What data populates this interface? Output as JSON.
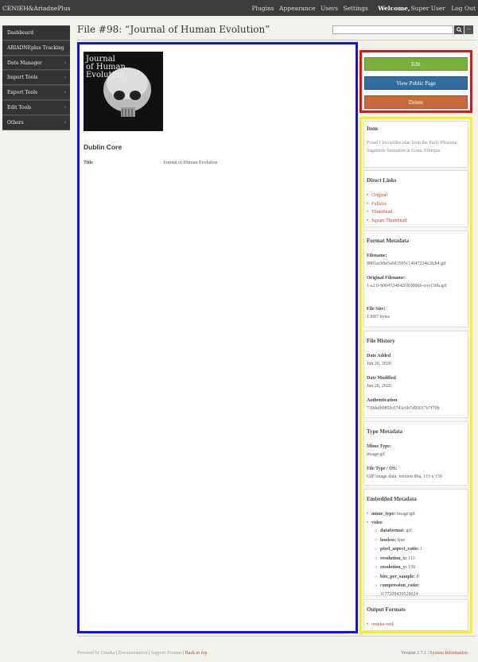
{
  "topbar": {
    "site_name": "CENIEH&AriadnePlus",
    "nav": [
      "Plugins",
      "Appearance",
      "Users",
      "Settings"
    ],
    "welcome": "Welcome,",
    "user": "Super User",
    "logout": "Log Out"
  },
  "sidebar": {
    "items": [
      {
        "label": "Dashboard",
        "chevron": ""
      },
      {
        "label": "ARIADNEplus Tracking",
        "chevron": ""
      },
      {
        "label": "Data Manager",
        "chevron": "›"
      },
      {
        "label": "Import Tools",
        "chevron": "›"
      },
      {
        "label": "Export Tools",
        "chevron": "›"
      },
      {
        "label": "Edit Tools",
        "chevron": "›"
      },
      {
        "label": "Others",
        "chevron": "›"
      }
    ]
  },
  "page": {
    "title": "File #98: “Journal of Human Evolution”"
  },
  "search": {
    "placeholder": "",
    "search_icon": "search-icon",
    "advanced_icon": "ellipsis-icon",
    "advanced_label": "..."
  },
  "main": {
    "image_text": [
      "Journal",
      "of Human",
      "Evolution"
    ],
    "dublin_core_title": "Dublin Core",
    "fields": [
      {
        "key": "Title",
        "value": "Journal of Human Evolution"
      }
    ]
  },
  "actions": {
    "edit": "Edit",
    "view_public": "View Public Page",
    "delete": "Delete"
  },
  "item": {
    "heading": "Item",
    "text": "Fossil Cercopithecidae from the Early Pliocene Sagantole formation at Gona, Ethiopia"
  },
  "direct_links": {
    "heading": "Direct Links",
    "links": [
      "Original",
      "Fullsize",
      "Thumbnail",
      "Square Thumbnail"
    ]
  },
  "format_metadata": {
    "heading": "Format Metadata",
    "filename_label": "Filename:",
    "filename": "8881acb9e5a6d3505c14f47224e2fcb4.gif",
    "original_label": "Original Filename:",
    "original": "1-s2.0-S0047248420X00066-cov150h.gif",
    "size_label": "File Size:",
    "size": "13087 bytes"
  },
  "file_history": {
    "heading": "File History",
    "added_label": "Date Added",
    "added": "Jun 26, 2020",
    "modified_label": "Date Modified",
    "modified": "Jun 26, 2020",
    "auth_label": "Authentication",
    "auth": "739defb985fc0743c6b7d93017e7f70b"
  },
  "type_metadata": {
    "heading": "Type Metadata",
    "mime_label": "Mime Type:",
    "mime": "image/gif",
    "filetype_label": "File Type / OS:",
    "filetype": "GIF image data, version 89a, 113 x 150"
  },
  "embedded": {
    "heading": "Embedded Metadata",
    "mime_type_key": "mime_type:",
    "mime_type_val": "image/gif",
    "video_key": "video",
    "video": [
      {
        "k": "dataformat:",
        "v": "gif"
      },
      {
        "k": "lossless:",
        "v": "true"
      },
      {
        "k": "pixel_aspect_ratio:",
        "v": "1"
      },
      {
        "k": "resolution_x:",
        "v": "113"
      },
      {
        "k": "resolution_y:",
        "v": "150"
      },
      {
        "k": "bits_per_sample:",
        "v": "8"
      },
      {
        "k": "compression_ratio:",
        "v": "0.77209439528024"
      }
    ]
  },
  "output_formats": {
    "heading": "Output Formats",
    "link": "omeka-xml"
  },
  "footer": {
    "powered": "Powered by Omeka",
    "documentation": "Documentation",
    "support": "Support Forums",
    "back": "Back to top",
    "version": "Version 2.7.1",
    "sysinfo": "System Information"
  },
  "colors": {
    "main_border": "#1010ee",
    "actions_border": "#ee1010",
    "info_border": "#f6f01c",
    "edit": "#79b23b",
    "view": "#316da3",
    "delete": "#c8693a"
  }
}
